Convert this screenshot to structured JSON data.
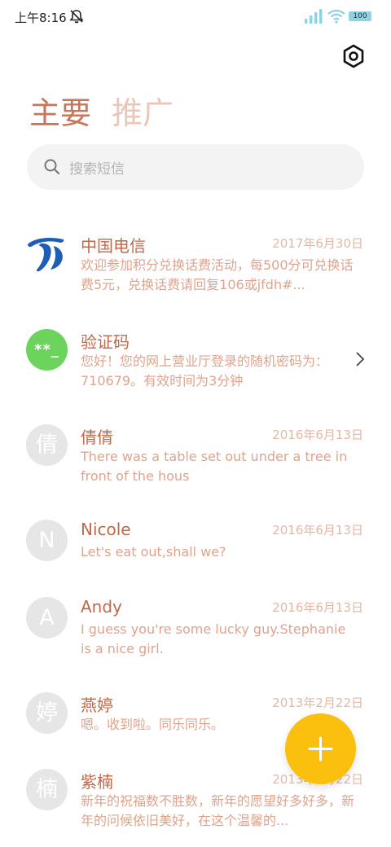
{
  "status_bar": {
    "time": "上午8:16",
    "battery": "100",
    "icons": [
      "bell-muted-icon",
      "signal-icon",
      "wifi-icon",
      "battery-icon"
    ]
  },
  "header": {
    "settings_icon": "gear-icon",
    "tabs": [
      {
        "label": "主要",
        "selected": true
      },
      {
        "label": "推广",
        "selected": false
      }
    ]
  },
  "search": {
    "placeholder": "搜索短信",
    "icon": "search-icon"
  },
  "messages": [
    {
      "avatar": "",
      "avatar_type": "telecom-logo",
      "name": "中国电信",
      "date": "2017年6月30日",
      "preview": "欢迎参加积分兑换话费活动，每500分可兑换话费5元，兑换话费请回复106或jfdh#..."
    },
    {
      "avatar": "**_",
      "avatar_type": "green",
      "name": "验证码",
      "date": "",
      "preview": "您好！您的网上营业厅登录的随机密码为：710679。有效时间为3分钟"
    },
    {
      "avatar": "倩",
      "avatar_type": "grey",
      "name": "倩倩",
      "date": "2016年6月13日",
      "preview": "There was a table set out under a tree in front of the hous"
    },
    {
      "avatar": "N",
      "avatar_type": "grey",
      "name": "Nicole",
      "date": "2016年6月13日",
      "preview": "Let's eat out,shall we?"
    },
    {
      "avatar": "A",
      "avatar_type": "grey",
      "name": "Andy",
      "date": "2016年6月13日",
      "preview": "I guess you're some lucky guy.Stephanie is a nice girl."
    },
    {
      "avatar": "婷",
      "avatar_type": "grey",
      "name": "燕婷",
      "date": "2013年2月22日",
      "preview": "嗯。收到啦。同乐同乐。"
    },
    {
      "avatar": "楠",
      "avatar_type": "grey",
      "name": "紫楠",
      "date": "2013年2月22日",
      "preview": "新年的祝福数不胜数，新年的愿望好多好多，新年的问候依旧美好，在这个温馨的..."
    }
  ],
  "colors": {
    "tab_active": "#c8765a",
    "tab_inactive": "#e9c6b8",
    "name": "#c0694a",
    "preview": "#dfa38c",
    "date": "#e2b8a6",
    "fab": "#fbbf0e",
    "verify_avatar": "#6cd35d",
    "telecom_logo": "#1d5fb5"
  },
  "fab": {
    "icon": "plus-icon"
  }
}
